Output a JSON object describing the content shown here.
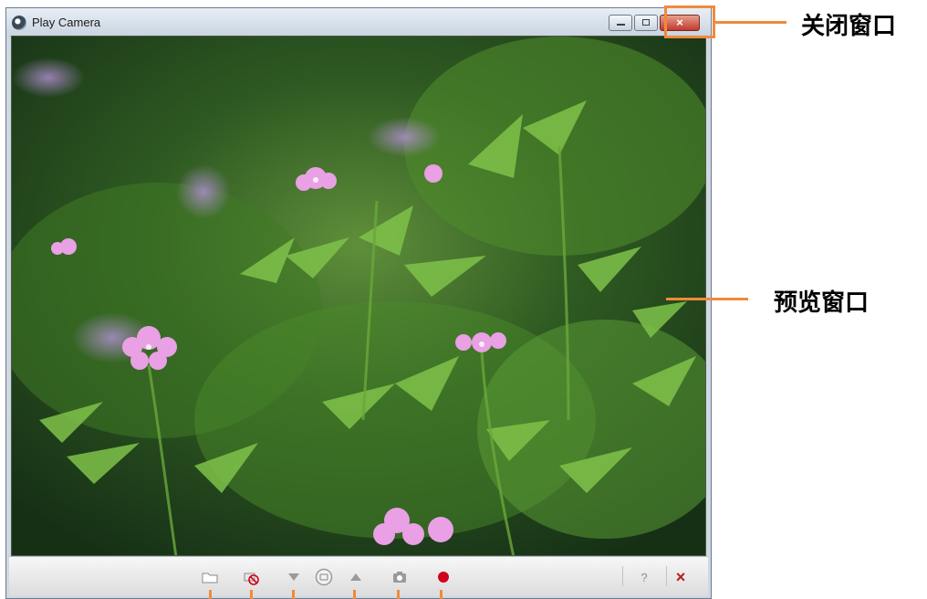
{
  "window": {
    "title": "Play Camera",
    "controls": {
      "minimize_icon": "minimize-icon",
      "maximize_icon": "maximize-icon",
      "close_label": "×"
    }
  },
  "preview": {
    "content": "camera preview image"
  },
  "toolbar": {
    "buttons": [
      {
        "icon": "folder-icon"
      },
      {
        "icon": "camera-off-icon"
      },
      {
        "icon": "triangle-down-icon"
      },
      {
        "icon": "target-icon"
      },
      {
        "icon": "triangle-up-icon"
      },
      {
        "icon": "camera-icon"
      },
      {
        "icon": "record-icon"
      }
    ],
    "help_label": "?",
    "close_label": "×"
  },
  "annotations": {
    "close_window": "关闭窗口",
    "preview_window": "预览窗口"
  },
  "colors": {
    "accent": "#f08a3c",
    "record": "#d0021b",
    "close_button": "#c0392b"
  }
}
